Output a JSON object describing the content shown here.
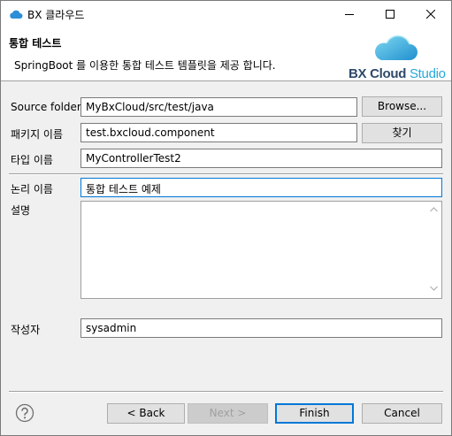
{
  "window": {
    "title": "BX 클라우드",
    "controls": [
      "minimize-icon",
      "maximize-icon",
      "close-icon"
    ]
  },
  "header": {
    "title": "통합 테스트",
    "description": "SpringBoot 를 이용한 통합 테스트 템플릿을 제공 합니다.",
    "logo_main": "BX Cloud",
    "logo_sub": "Studio"
  },
  "form": {
    "source_folder": {
      "label": "Source folder:",
      "value": "MyBxCloud/src/test/java",
      "button": "Browse..."
    },
    "package": {
      "label": "패키지 이름",
      "value": "test.bxcloud.component",
      "button": "찾기"
    },
    "type": {
      "label": "타입 이름",
      "value": "MyControllerTest2"
    },
    "logical_name": {
      "label": "논리 이름",
      "value": "통합 테스트 예제"
    },
    "description": {
      "label": "설명",
      "value": ""
    },
    "author": {
      "label": "작성자",
      "value": "sysadmin"
    }
  },
  "footer": {
    "back": "< Back",
    "next": "Next >",
    "finish": "Finish",
    "cancel": "Cancel"
  },
  "colors": {
    "accent": "#0078d7",
    "logo_dark": "#2f4a6a",
    "logo_light": "#27a8d8"
  }
}
